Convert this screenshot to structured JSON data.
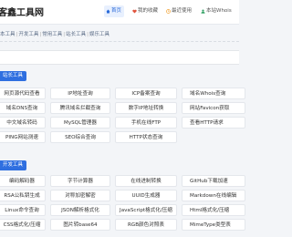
{
  "header": {
    "logo": "客鑫工具网",
    "nav": [
      {
        "label": "首页",
        "icon": "home-icon",
        "active": true
      },
      {
        "label": "我的收藏",
        "icon": "heart-icon",
        "active": false
      },
      {
        "label": "最近使用",
        "icon": "clock-icon",
        "active": false
      },
      {
        "label": "本站Whois",
        "icon": "user-icon",
        "active": false
      }
    ]
  },
  "breadcrumb": [
    "本工具",
    "开发工具",
    "常用工具",
    "站长工具",
    "娱乐工具"
  ],
  "sections": [
    {
      "label": "站长工具",
      "rows": [
        [
          "网页源代码查看",
          "IP地址查询",
          "ICP备案查询",
          "域名Whois查询"
        ],
        [
          "域名DNS查询",
          "腾讯域名拦截查询",
          "数字IP地址转换",
          "网站Favicon获取"
        ],
        [
          "中文域名转码",
          "MySQL管理器",
          "手机在线FTP",
          "查看HTTP请求"
        ],
        [
          "PING网站测速",
          "SEO综合查询",
          "HTTP状态查询",
          ""
        ]
      ]
    },
    {
      "label": "开发工具",
      "rows": [
        [
          "编码解码器",
          "字节计算器",
          "在线进制转换",
          "GitHub下载加速"
        ],
        [
          "RSA公私钥生成",
          "对称加密解密",
          "UUID生成器",
          "Markdown在线编辑"
        ],
        [
          "Linux命令查询",
          "JSON解析格式化",
          "JavaScript格式化/压缩",
          "Html格式化/压缩"
        ],
        [
          "CSS格式化/压缩",
          "图片转base64",
          "RGB颜色对照表",
          "MimeType类型表"
        ]
      ]
    }
  ]
}
